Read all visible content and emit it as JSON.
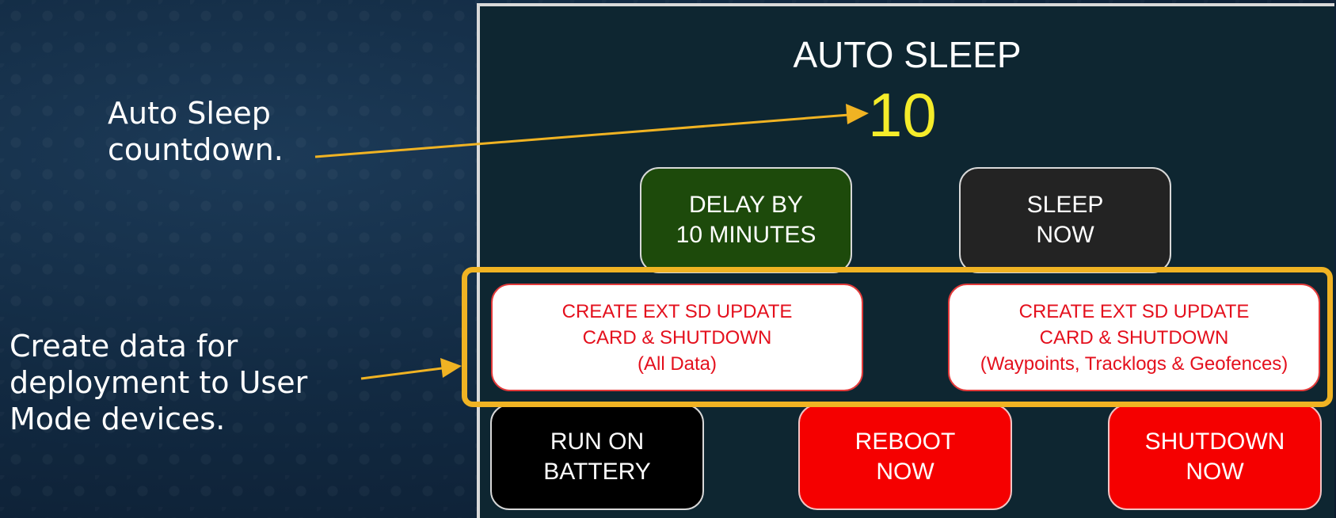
{
  "annotations": {
    "auto_sleep_line1": "Auto Sleep",
    "auto_sleep_line2": "countdown.",
    "create_line1": "Create data for",
    "create_line2": "deployment to User",
    "create_line3": "Mode devices."
  },
  "dialog": {
    "title": "AUTO SLEEP",
    "countdown": "10"
  },
  "buttons": {
    "delay": {
      "line1": "DELAY BY",
      "line2": "10 MINUTES"
    },
    "sleep": {
      "line1": "SLEEP",
      "line2": "NOW"
    },
    "sd_all": {
      "line1": "CREATE EXT SD UPDATE",
      "line2": "CARD & SHUTDOWN",
      "line3": "(All Data)"
    },
    "sd_waypoints": {
      "line1": "CREATE EXT SD UPDATE",
      "line2": "CARD & SHUTDOWN",
      "line3": "(Waypoints, Tracklogs & Geofences)"
    },
    "battery": {
      "line1": "RUN ON",
      "line2": "BATTERY"
    },
    "reboot": {
      "line1": "REBOOT",
      "line2": "NOW"
    },
    "shutdown": {
      "line1": "SHUTDOWN",
      "line2": "NOW"
    }
  },
  "colors": {
    "annotation_accent": "#f0b323",
    "countdown": "#f5ec2a",
    "delay_button": "#1d4a0b",
    "danger": "#f50000",
    "danger_text": "#e4101d"
  }
}
